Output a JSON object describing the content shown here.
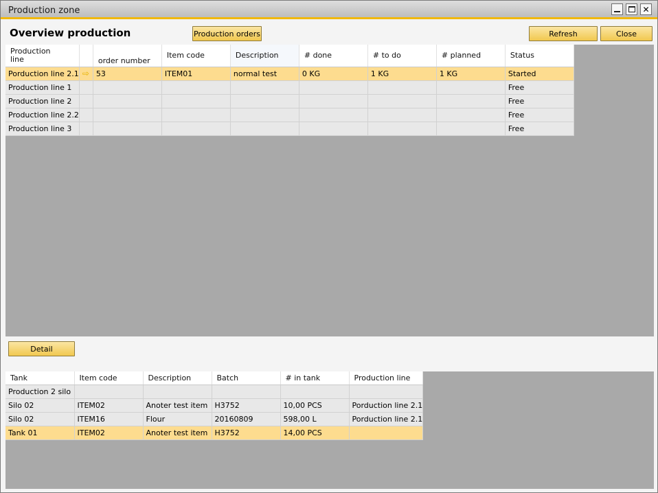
{
  "window": {
    "title": "Production zone"
  },
  "heading": "Overview production",
  "buttons": {
    "production_orders": "Production orders",
    "refresh": "Refresh",
    "close": "Close",
    "detail": "Detail"
  },
  "top_table": {
    "headers": {
      "production_line": "Production\nline",
      "order_number": "order number",
      "item_code": "Item code",
      "description": "Description",
      "done": "# done",
      "to_do": "# to do",
      "planned": "# planned",
      "status": "Status"
    },
    "rows": [
      {
        "line": "Porduction line 2.1",
        "indicator": "⇨",
        "order": "53",
        "item": "ITEM01",
        "desc": "normal test",
        "done": "0 KG",
        "todo": "1 KG",
        "planned": "1 KG",
        "status": "Started"
      },
      {
        "line": "Production line 1",
        "indicator": "",
        "order": "",
        "item": "",
        "desc": "",
        "done": "",
        "todo": "",
        "planned": "",
        "status": "Free"
      },
      {
        "line": "Production line 2",
        "indicator": "",
        "order": "",
        "item": "",
        "desc": "",
        "done": "",
        "todo": "",
        "planned": "",
        "status": "Free"
      },
      {
        "line": "Production line 2.2",
        "indicator": "",
        "order": "",
        "item": "",
        "desc": "",
        "done": "",
        "todo": "",
        "planned": "",
        "status": "Free"
      },
      {
        "line": "Production line 3",
        "indicator": "",
        "order": "",
        "item": "",
        "desc": "",
        "done": "",
        "todo": "",
        "planned": "",
        "status": "Free"
      }
    ]
  },
  "bottom_table": {
    "headers": {
      "tank": "Tank",
      "item_code": "Item code",
      "description": "Description",
      "batch": "Batch",
      "in_tank": "# in tank",
      "production_line": "Production line"
    },
    "rows": [
      {
        "tank": "Production 2 silo",
        "item": "",
        "desc": "",
        "batch": "",
        "qty": "",
        "line": ""
      },
      {
        "tank": "Silo 02",
        "item": "ITEM02",
        "desc": "Anoter test item",
        "batch": "H3752",
        "qty": "10,00 PCS",
        "line": "Porduction line 2.1"
      },
      {
        "tank": "Silo 02",
        "item": "ITEM16",
        "desc": "Flour",
        "batch": "20160809",
        "qty": "598,00 L",
        "line": "Porduction line 2.1"
      },
      {
        "tank": "Tank 01",
        "item": "ITEM02",
        "desc": "Anoter test item",
        "batch": "H3752",
        "qty": "14,00 PCS",
        "line": ""
      }
    ]
  }
}
